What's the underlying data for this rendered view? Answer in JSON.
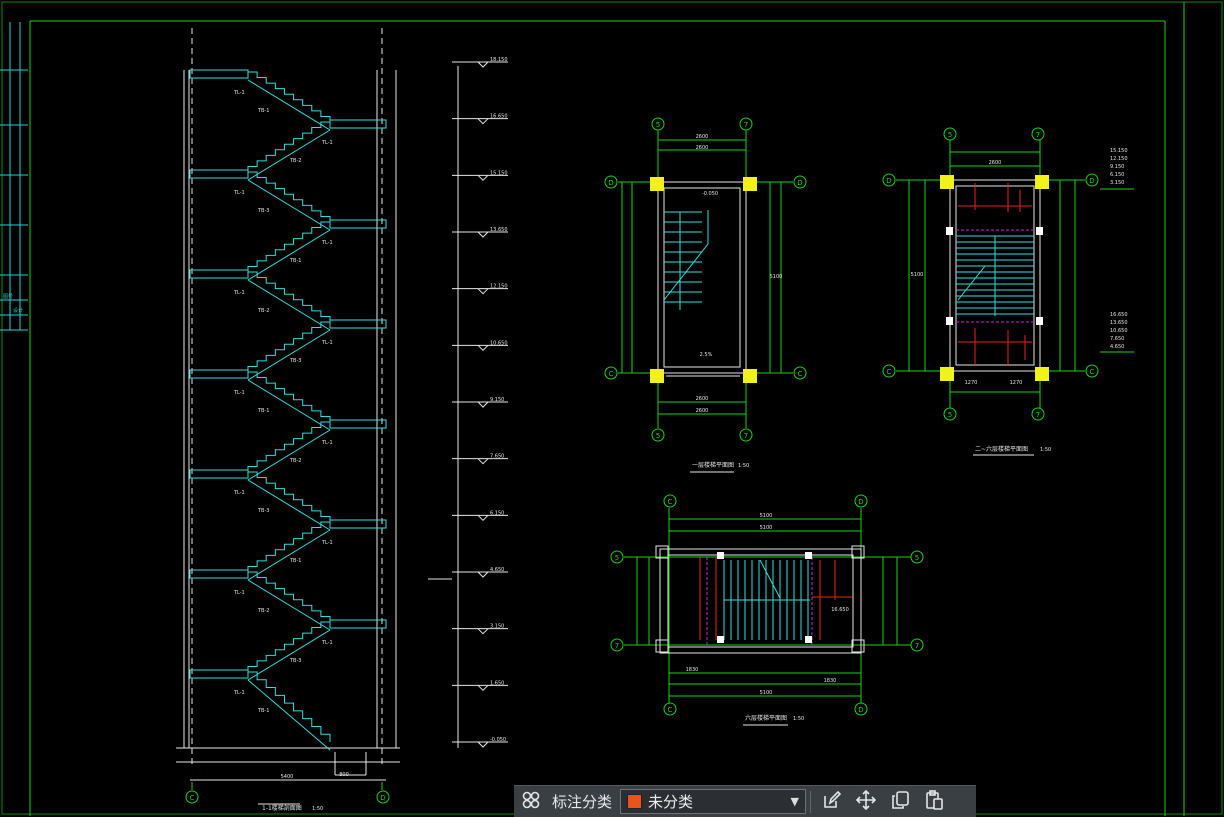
{
  "section_view": {
    "title": "1-1楼梯剖面图",
    "scale": "1:50",
    "axis_left": "C",
    "axis_right": "D",
    "flight_labels": [
      "TB-1",
      "TB-2",
      "TB-3"
    ],
    "beam_label": "TL-1",
    "elevations": [
      "18.150",
      "16.650",
      "15.150",
      "13.650",
      "12.150",
      "10.650",
      "9.150",
      "7.650",
      "6.150",
      "4.650",
      "3.150",
      "1.650",
      "-0.050"
    ],
    "bottom_dim": "5400",
    "base_dim": "800"
  },
  "plan_ground": {
    "title": "一层楼梯平面图",
    "scale": "1:50",
    "axes": [
      "5",
      "7",
      "D",
      "C"
    ],
    "dims_top": [
      "2600",
      "2600"
    ],
    "dims_bottom": [
      "2600",
      "2600"
    ],
    "dim_side": "5100",
    "level": "-0.050",
    "slope_note": "2.5%"
  },
  "plan_typical": {
    "title": "二~六层楼梯平面图",
    "scale": "1:50",
    "axes": [
      "5",
      "7",
      "D",
      "C"
    ],
    "dim_top": "2600",
    "dim_side": "5100",
    "dims_bottom": [
      "1270",
      "1270"
    ],
    "levels_top": [
      "15.150",
      "12.150",
      "9.150",
      "6.150",
      "3.150"
    ],
    "levels_bottom": [
      "16.650",
      "13.650",
      "10.650",
      "7.650",
      "4.650"
    ]
  },
  "plan_roof": {
    "title": "六层楼梯平面图",
    "scale": "1:50",
    "axes": [
      "5",
      "7",
      "C",
      "D"
    ],
    "dims_top": [
      "5100",
      "5100"
    ],
    "dims_bottom": [
      "1830",
      "1830",
      "5100"
    ],
    "level": "16.650"
  },
  "left_strip_marks": [
    "图号",
    "设计"
  ],
  "toolbar": {
    "grid_icon": "grid-four-icon",
    "category_label": "标注分类",
    "select_value": "未分类",
    "select_color": "#e8541a",
    "dropdown_icon": "chevron-down-icon",
    "edit_icon": "edit-icon",
    "move_icon": "move-icon",
    "copy_icon": "copy-icon",
    "paste_icon": "paste-icon"
  }
}
